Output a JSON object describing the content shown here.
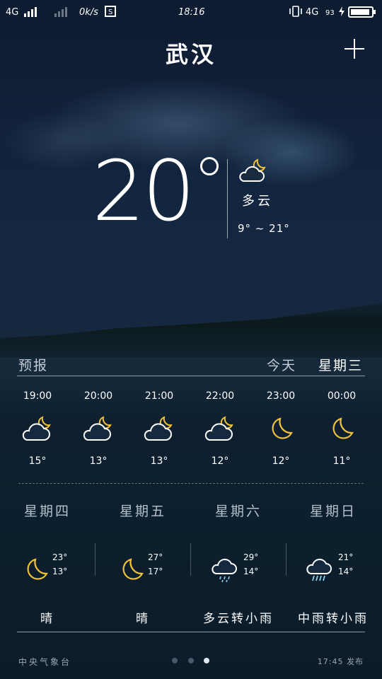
{
  "status_bar": {
    "network1": "4G",
    "speed": "0k/s",
    "time": "18:16",
    "network2": "4G",
    "battery_level": "93",
    "battery_fraction": 0.93
  },
  "header": {
    "city": "武汉"
  },
  "current": {
    "temp": "20",
    "condition": "多云",
    "range": "9° ~ 21°",
    "icon": "cloud-moon-icon"
  },
  "forecast": {
    "label": "预报",
    "today": "今天",
    "weekday": "星期三",
    "hourly": [
      {
        "time": "19:00",
        "icon": "cloud-moon-icon",
        "temp": "15°"
      },
      {
        "time": "20:00",
        "icon": "cloud-moon-icon",
        "temp": "13°"
      },
      {
        "time": "21:00",
        "icon": "cloud-moon-icon",
        "temp": "13°"
      },
      {
        "time": "22:00",
        "icon": "cloud-moon-icon",
        "temp": "12°"
      },
      {
        "time": "23:00",
        "icon": "moon-icon",
        "temp": "12°"
      },
      {
        "time": "00:00",
        "icon": "moon-icon",
        "temp": "11°"
      }
    ],
    "daily": [
      {
        "day": "星期四",
        "icon": "moon-icon",
        "high": "23°",
        "low": "13°",
        "desc": "晴"
      },
      {
        "day": "星期五",
        "icon": "moon-icon",
        "high": "27°",
        "low": "17°",
        "desc": "晴"
      },
      {
        "day": "星期六",
        "icon": "cloud-rain-icon",
        "high": "29°",
        "low": "14°",
        "desc": "多云转小雨"
      },
      {
        "day": "星期日",
        "icon": "cloud-heavy-rain-icon",
        "high": "21°",
        "low": "14°",
        "desc": "中雨转小雨"
      }
    ]
  },
  "footer": {
    "source": "中央气象台",
    "publish": "17:45 发布",
    "pages": 3,
    "active_page": 3
  }
}
